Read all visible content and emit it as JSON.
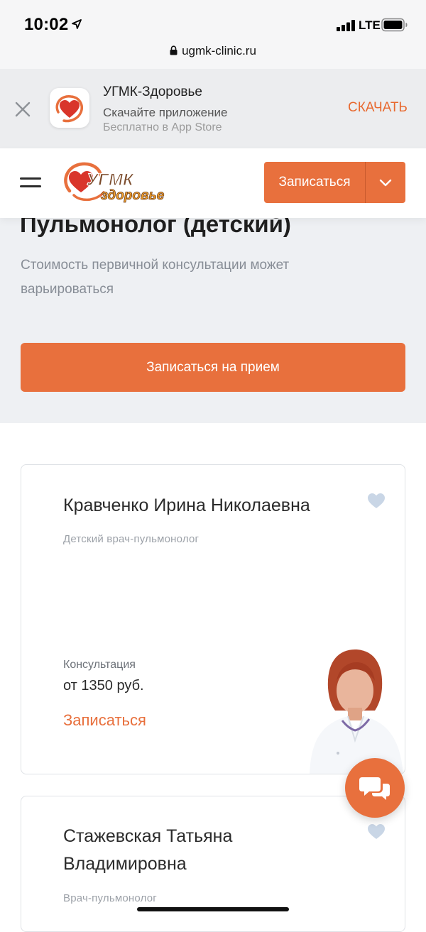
{
  "status_bar": {
    "time": "10:02",
    "network": "LTE"
  },
  "browser": {
    "url": "ugmk-clinic.ru"
  },
  "app_banner": {
    "app_name": "УГМК-Здоровье",
    "subtitle": "Скачайте приложение",
    "store_text": "Бесплатно в App Store",
    "download_label": "СКАЧАТЬ"
  },
  "header": {
    "logo_text_top": "УГМК",
    "logo_text_bottom": "здоровье",
    "book_button_label": "Записаться"
  },
  "hero": {
    "title": "Пульмонолог (детский)",
    "cost_note": "Стоимость первичной консультации может варьироваться",
    "book_button_label": "Записаться на прием"
  },
  "doctors": [
    {
      "name": "Кравченко Ирина Николаевна",
      "specialty": "Детский врач-пульмонолог",
      "consult_label": "Консультация",
      "price": "от 1350 руб.",
      "book_label": "Записаться"
    },
    {
      "name_line1": "Стажевская Татьяна",
      "name_line2": "Владимировна",
      "specialty": "Врач-пульмонолог"
    }
  ],
  "colors": {
    "accent": "#e8703d",
    "hero_bg": "#eef0f3",
    "favorite_icon": "#c9d6e6",
    "muted_text": "#9ca1a8"
  },
  "icons": {
    "banner_close": "close-icon",
    "menu": "hamburger-icon",
    "dropdown": "chevron-down-icon",
    "favorite": "heart-icon",
    "chat": "chat-bubbles-icon",
    "lock": "lock-icon"
  }
}
